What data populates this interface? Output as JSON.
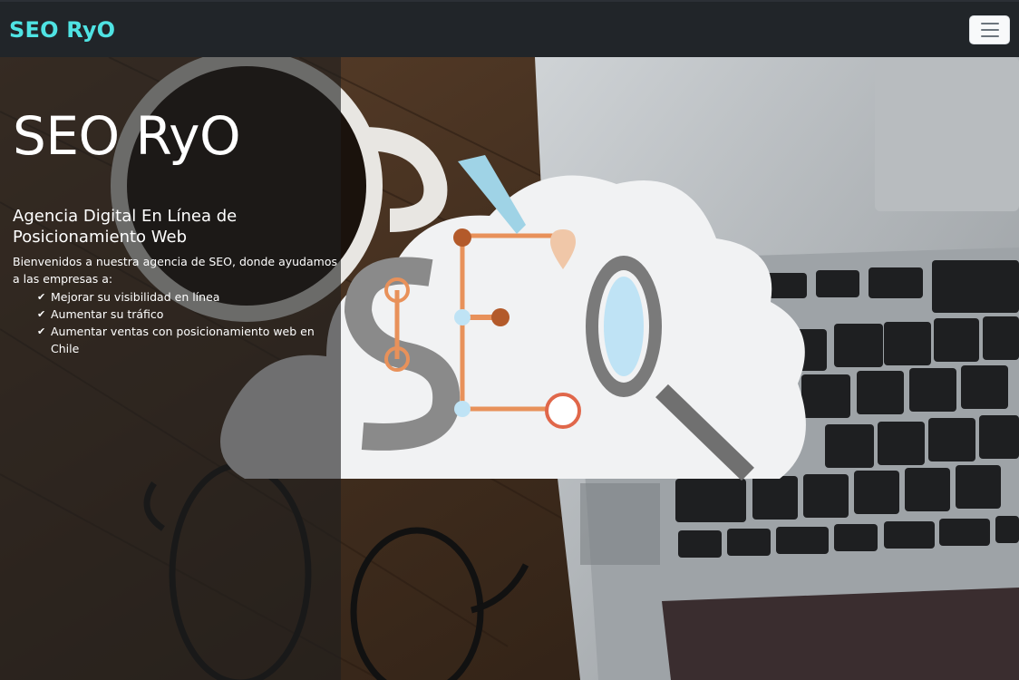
{
  "navbar": {
    "brand": "SEO RyO",
    "toggler_icon": "hamburger-menu-icon"
  },
  "hero": {
    "title": "SEO RyO",
    "subtitle": "Agencia Digital En Línea de Posicionamiento Web",
    "intro": "Bienvenidos a nuestra agencia de SEO, donde ayudamos a las empresas a:",
    "bullets": [
      "Mejorar su visibilidad en línea",
      "Aumentar su tráfico",
      "Aumentar ventas con posicionamiento web en Chile"
    ],
    "bullet_icon": "checkmark-icon",
    "image_text": "SEO"
  },
  "colors": {
    "brand": "#4fe3e3",
    "navbar_bg": "#212529",
    "accent_orange": "#e8915a",
    "accent_brown": "#b35a2a"
  }
}
